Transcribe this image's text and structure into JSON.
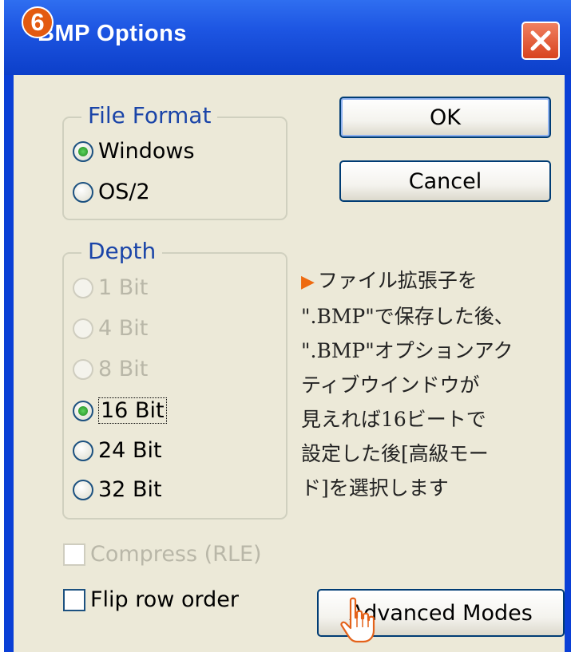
{
  "window": {
    "title": "BMP Options",
    "step_badge": "6",
    "title_bar_color": "#1d55e2",
    "close_button_color": "#d8431f"
  },
  "file_format": {
    "legend": "File Format",
    "options": [
      {
        "label": "Windows",
        "selected": true
      },
      {
        "label": "OS/2",
        "selected": false
      }
    ]
  },
  "depth": {
    "legend": "Depth",
    "options": [
      {
        "label": "1 Bit",
        "selected": false,
        "disabled": true
      },
      {
        "label": "4 Bit",
        "selected": false,
        "disabled": true
      },
      {
        "label": "8 Bit",
        "selected": false,
        "disabled": true
      },
      {
        "label": "16 Bit",
        "selected": true,
        "disabled": false
      },
      {
        "label": "24 Bit",
        "selected": false,
        "disabled": false
      },
      {
        "label": "32 Bit",
        "selected": false,
        "disabled": false
      }
    ]
  },
  "compress": {
    "label": "Compress (RLE)",
    "checked": false,
    "disabled": true
  },
  "flip": {
    "label": "Flip row order",
    "checked": false,
    "disabled": false
  },
  "buttons": {
    "ok": "OK",
    "cancel": "Cancel",
    "advanced": "Advanced Modes"
  },
  "annotation": {
    "marker_color": "#ee6a10",
    "lines": [
      "ファイル拡張子を",
      "\".BMP\"で保存した後、",
      "\".BMP\"オプションアク",
      "ティブウインドウが",
      "見えれば16ビートで",
      "設定した後[高級モー",
      "ド]を選択します"
    ]
  },
  "icons": {
    "close": "close-icon",
    "cursor": "hand-pointer-icon",
    "marker": "triangle-right-icon"
  }
}
